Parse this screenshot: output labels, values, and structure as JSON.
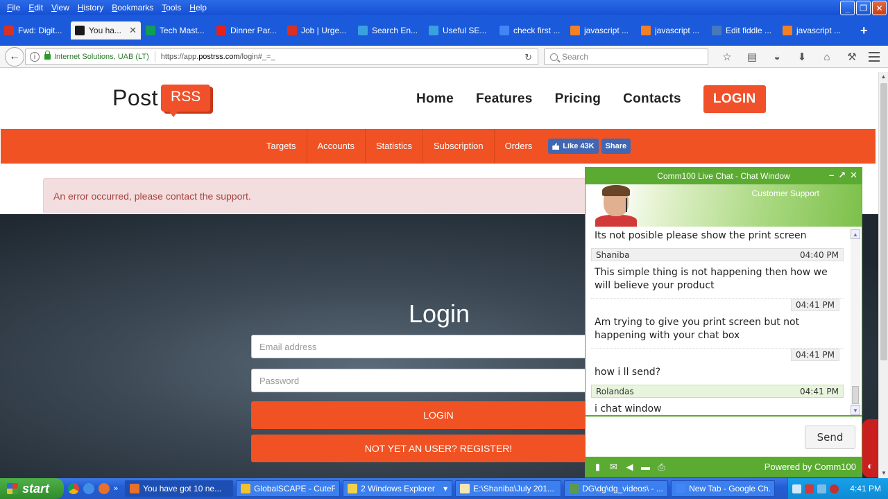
{
  "menu": [
    "File",
    "Edit",
    "View",
    "History",
    "Bookmarks",
    "Tools",
    "Help"
  ],
  "tabs": [
    {
      "title": "Fwd: Digit...",
      "icon": "gmail-icon",
      "color": "#d93025"
    },
    {
      "title": "You ha...",
      "icon": "symfony-icon",
      "color": "#1a1a1a",
      "active": true
    },
    {
      "title": "Tech Mast...",
      "icon": "sheets-icon",
      "color": "#0f9d58"
    },
    {
      "title": "Dinner Par...",
      "icon": "youtube-icon",
      "color": "#e62117"
    },
    {
      "title": "Job | Urge...",
      "icon": "gmail-icon",
      "color": "#d93025"
    },
    {
      "title": "Search En...",
      "icon": "bookmark-icon",
      "color": "#3aa0e0"
    },
    {
      "title": "Useful SE...",
      "icon": "bookmark-icon",
      "color": "#3aa0e0"
    },
    {
      "title": "check first ...",
      "icon": "google-icon",
      "color": "#4285f4"
    },
    {
      "title": "javascript ...",
      "icon": "stackoverflow-icon",
      "color": "#f48024"
    },
    {
      "title": "javascript ...",
      "icon": "stackoverflow-icon",
      "color": "#f48024"
    },
    {
      "title": "Edit fiddle ...",
      "icon": "jsfiddle-icon",
      "color": "#4679bd"
    },
    {
      "title": "javascript ...",
      "icon": "stackoverflow-icon",
      "color": "#f48024"
    }
  ],
  "address": {
    "identity": "Internet Solutions, UAB (LT)",
    "url_prefix": "https://app.",
    "url_domain": "postrss.com",
    "url_suffix": "/login#_=_"
  },
  "search_placeholder": "Search",
  "site": {
    "logo_post": "Post",
    "logo_rss": "RSS",
    "nav": [
      "Home",
      "Features",
      "Pricing",
      "Contacts"
    ],
    "nav_login": "LOGIN",
    "subnav": [
      "Targets",
      "Accounts",
      "Statistics",
      "Subscription",
      "Orders"
    ],
    "fb_like": "Like 43K",
    "fb_share": "Share",
    "error": "An error occurred, please contact the support.",
    "login_title": "Login",
    "email_placeholder": "Email address",
    "password_placeholder": "Password",
    "login_button": "LOGIN",
    "register_button": "NOT YET AN USER? REGISTER!",
    "accent_color": "#f05223"
  },
  "chat": {
    "title": "Comm100 Live Chat - Chat Window",
    "support_label": "Customer Support",
    "messages": [
      {
        "type": "text",
        "text": "Its not posible please show the print screen"
      },
      {
        "type": "header",
        "name": "Shaniba",
        "time": "04:40 PM"
      },
      {
        "type": "text",
        "text": "This simple thing is not happening then how we will believe your product"
      },
      {
        "type": "time",
        "time": "04:41 PM"
      },
      {
        "type": "text",
        "text": "Am trying to give you print screen but not happening with your chat box"
      },
      {
        "type": "time",
        "time": "04:41 PM"
      },
      {
        "type": "text",
        "text": "how i ll send?"
      },
      {
        "type": "agent",
        "name": "Rolandas",
        "time": "04:41 PM"
      },
      {
        "type": "text",
        "text": "i chat window"
      }
    ],
    "send": "Send",
    "powered": "Powered by Comm100"
  },
  "taskbar": {
    "start": "start",
    "items": [
      {
        "title": "You have got 10 ne...",
        "color": "#e8702a",
        "active": true
      },
      {
        "title": "GlobalSCAPE - CuteF...",
        "color": "#f2c12e"
      },
      {
        "title": "2 Windows Explorer",
        "color": "#f2d24a",
        "group": true
      },
      {
        "title": "E:\\Shaniba\\July 201...",
        "color": "#f4e6b0"
      },
      {
        "title": "DG\\dg\\dg_videos\\ - ...",
        "color": "#5a9a4a"
      },
      {
        "title": "New Tab - Google Ch...",
        "color": "#4285f4"
      }
    ],
    "clock": "4:41 PM"
  }
}
